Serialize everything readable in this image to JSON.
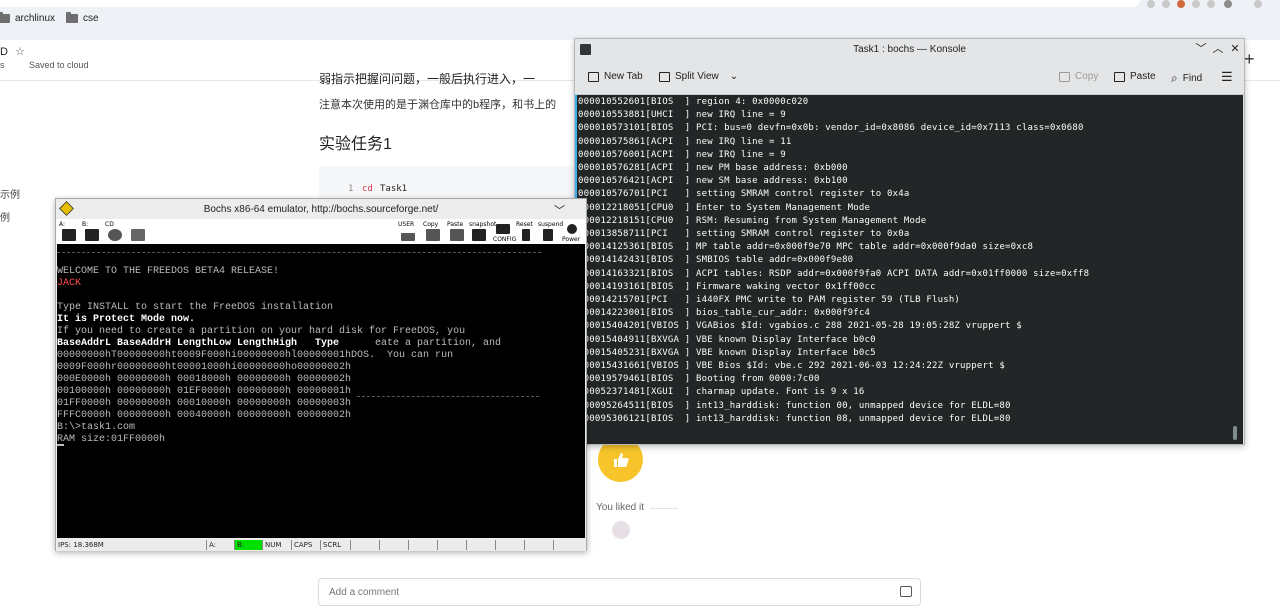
{
  "browser": {
    "bookmarks": [
      "archlinux",
      "cse"
    ]
  },
  "doc": {
    "title_fragment": "D",
    "star_glyph": "☆",
    "status_left": "s",
    "saved": "Saved to cloud",
    "truncated_line": "弱指示把握问问题，一般后执行进入，一",
    "note": "注意本次使用的是于渊仓库中的b程序，和书上的",
    "heading": "实验任务1",
    "code_line_no": "1",
    "code_keyword": "cd",
    "code_arg": "Task1",
    "side1": "示例",
    "side2": "例",
    "liked": "You liked it",
    "comment_placeholder": "Add a comment"
  },
  "konsole": {
    "title": "Task1 : bochs — Konsole",
    "new_tab": "New Tab",
    "split_view": "Split View",
    "copy": "Copy",
    "paste": "Paste",
    "find": "Find",
    "lines": [
      "000010552601[BIOS  ] region 4: 0x0000c020",
      "000010553881[UHCI  ] new IRQ line = 9",
      "000010573101[BIOS  ] PCI: bus=0 devfn=0x0b: vendor_id=0x8086 device_id=0x7113 class=0x0680",
      "000010575861[ACPI  ] new IRQ line = 11",
      "000010576001[ACPI  ] new IRQ line = 9",
      "000010576281[ACPI  ] new PM base address: 0xb000",
      "000010576421[ACPI  ] new SM base address: 0xb100",
      "000010576701[PCI   ] setting SMRAM control register to 0x4a",
      "000012218051[CPU0  ] Enter to System Management Mode",
      "000012218151[CPU0  ] RSM: Resuming from System Management Mode",
      "000013858711[PCI   ] setting SMRAM control register to 0x0a",
      "000014125361[BIOS  ] MP table addr=0x000f9e70 MPC table addr=0x000f9da0 size=0xc8",
      "000014142431[BIOS  ] SMBIOS table addr=0x000f9e80",
      "000014163321[BIOS  ] ACPI tables: RSDP addr=0x000f9fa0 ACPI DATA addr=0x01ff0000 size=0xff8",
      "000014193161[BIOS  ] Firmware waking vector 0x1ff00cc",
      "000014215701[PCI   ] i440FX PMC write to PAM register 59 (TLB Flush)",
      "000014223001[BIOS  ] bios_table_cur_addr: 0x000f9fc4",
      "000015404201[VBIOS ] VGABios $Id: vgabios.c 288 2021-05-28 19:05:28Z vruppert $",
      "000015404911[BXVGA ] VBE known Display Interface b0c0",
      "000015405231[BXVGA ] VBE known Display Interface b0c5",
      "000015431661[VBIOS ] VBE Bios $Id: vbe.c 292 2021-06-03 12:24:22Z vruppert $",
      "000019579461[BIOS  ] Booting from 0000:7c00",
      "000052371481[XGUI  ] charmap update. Font is 9 x 16",
      "000095264511[BIOS  ] int13_harddisk: function 00, unmapped device for ELDL=80",
      "000095306121[BIOS  ] int13_harddisk: function 08, unmapped device for ELDL=80"
    ]
  },
  "bochs": {
    "title": "Bochs x86-64 emulator, http://bochs.sourceforge.net/",
    "tools": [
      "A:",
      "B:",
      "CD",
      "USER",
      "Copy",
      "Paste",
      "snapshot",
      "CONFIG",
      "Reset",
      "suspend",
      "Power"
    ],
    "screen": {
      "welcome": "WELCOME TO THE FREEDOS BETA4 RELEASE!",
      "jack": "JACK",
      "install": "Type INSTALL to start the FreeDOS installation",
      "protect": "It is Protect Mode now.",
      "partition": "If you need to create a partition on your hard disk for FreeDOS, you",
      "header_bold": "BaseAddrL BaseAddrH LengthLow LengthHigh   Type",
      "header_tail": "eate a partition, and",
      "row1": "00000000hT00000000ht0009F000hi00000000hl00000001hDOS.  You can run",
      "row2": "0009F000hr00000000ht00001000hi00000000ho00000002h",
      "row3": "000E0000h 00000000h 00018000h 00000000h 00000002h",
      "row4": "00100000h 00000000h 01EF0000h 00000000h 00000001h",
      "row5": "01FF0000h 00000000h 00010000h 00000000h 00000003h",
      "row6": "FFFC0000h 00000000h 00040000h 00000000h 00000002h",
      "prompt": "B:\\>task1.com",
      "ram": "RAM size:01FF0000h"
    },
    "status": {
      "ips": "IPS: 18.368M",
      "a": "A:",
      "b": "B:",
      "num": "NUM",
      "caps": "CAPS",
      "scrl": "SCRL"
    }
  },
  "colors": {
    "terminal_bg": "#232627",
    "accent_yellow": "#f7c52b",
    "status_green": "#00e000"
  }
}
